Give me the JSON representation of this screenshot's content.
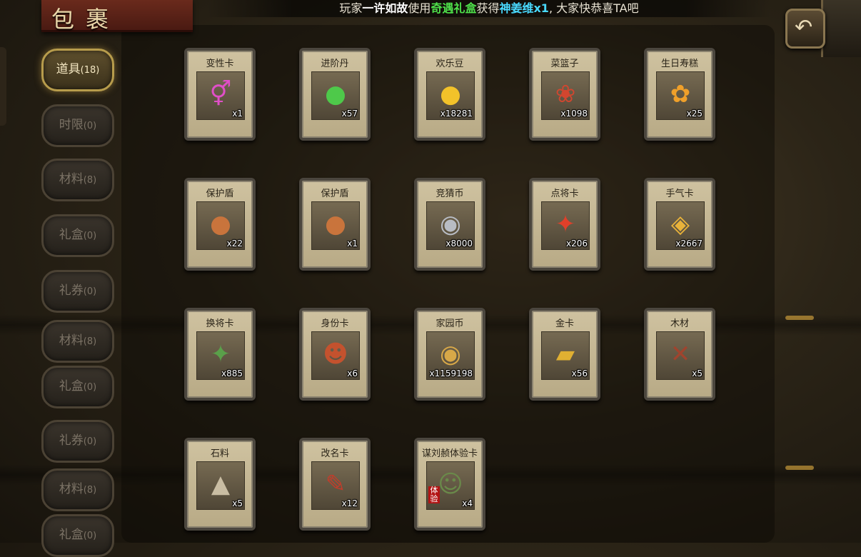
{
  "title": "包裹",
  "marquee": {
    "p1": "玩家",
    "player": "一许如故",
    "p2": "使用",
    "item_used": "奇遇礼盒",
    "p3": "获得",
    "reward": "神姜维x1",
    "p4": ", 大家快恭喜TA吧"
  },
  "sidebar": {
    "tabs": [
      {
        "label": "道具",
        "count": "(18)"
      },
      {
        "label": "时限",
        "count": "(0)"
      },
      {
        "label": "材料",
        "count": "(8)"
      },
      {
        "label": "礼盒",
        "count": "(0)"
      },
      {
        "label": "礼券",
        "count": "(0)"
      },
      {
        "label": "材料",
        "count": "(8)"
      },
      {
        "label": "礼盒",
        "count": "(0)"
      },
      {
        "label": "礼券",
        "count": "(0)"
      },
      {
        "label": "材料",
        "count": "(8)"
      },
      {
        "label": "礼盒",
        "count": "(0)"
      }
    ]
  },
  "items": [
    {
      "name": "变性卡",
      "qty": "x1",
      "icon": "gender-symbols-icon",
      "color": "#e04fc8"
    },
    {
      "name": "进阶丹",
      "qty": "x57",
      "icon": "green-pill-icon",
      "color": "#4ec94a"
    },
    {
      "name": "欢乐豆",
      "qty": "x18281",
      "icon": "gold-beans-icon",
      "color": "#f2c22a"
    },
    {
      "name": "菜篮子",
      "qty": "x1098",
      "icon": "basket-icon",
      "color": "#d3462f"
    },
    {
      "name": "生日寿糕",
      "qty": "x25",
      "icon": "cake-icon",
      "color": "#f0a02a"
    },
    {
      "name": "保护盾",
      "qty": "x22",
      "icon": "shield-icon",
      "color": "#c9743c"
    },
    {
      "name": "保护盾",
      "qty": "x1",
      "icon": "shield-icon",
      "color": "#c9743c"
    },
    {
      "name": "竞猜币",
      "qty": "x8000",
      "icon": "silver-coin-icon",
      "color": "#b8bcc4"
    },
    {
      "name": "点将卡",
      "qty": "x206",
      "icon": "general-card-icon",
      "color": "#e0402a"
    },
    {
      "name": "手气卡",
      "qty": "x2667",
      "icon": "luck-card-icon",
      "color": "#e9b33a"
    },
    {
      "name": "换将卡",
      "qty": "x885",
      "icon": "swap-general-card-icon",
      "color": "#5aa04a"
    },
    {
      "name": "身份卡",
      "qty": "x6",
      "icon": "mask-card-icon",
      "color": "#c4522e"
    },
    {
      "name": "家园币",
      "qty": "x1159198",
      "icon": "home-coin-icon",
      "color": "#d8a848"
    },
    {
      "name": "金卡",
      "qty": "x56",
      "icon": "gold-card-icon",
      "color": "#e0b032"
    },
    {
      "name": "木材",
      "qty": "x5",
      "icon": "wood-icon",
      "color": "#a0442e"
    },
    {
      "name": "石料",
      "qty": "x5",
      "icon": "stone-icon",
      "color": "#c9bda3"
    },
    {
      "name": "改名卡",
      "qty": "x12",
      "icon": "rename-card-icon",
      "color": "#c43c2a"
    },
    {
      "name": "谋刘赪体验卡",
      "qty": "x4",
      "icon": "hero-portrait-icon",
      "color": "#6a8a4a",
      "badge": "体验"
    }
  ]
}
